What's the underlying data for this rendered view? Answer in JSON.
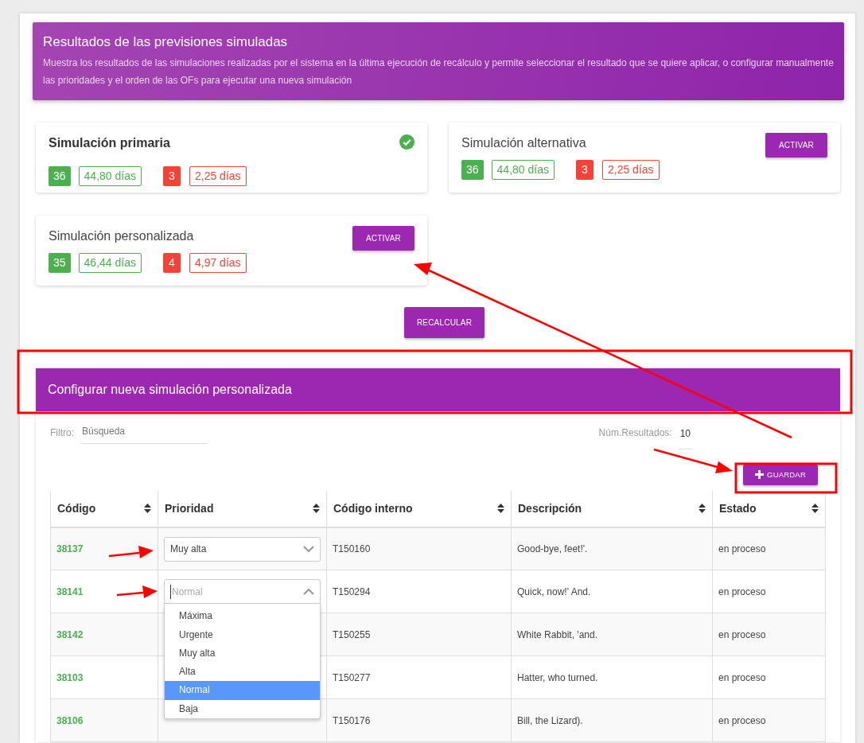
{
  "header": {
    "title": "Resultados de las previsiones simuladas",
    "description": "Muestra los resultados de las simulaciones realizadas por el sistema en la última ejecución de recálculo y permite seleccionar el resultado que se quiere aplicar, o configurar manualmente las prioridades y el orden de las OFs para ejecutar una nueva simulación"
  },
  "simulations": [
    {
      "title": "Simulación primaria",
      "active": true,
      "on_time_count": "36",
      "on_time_days": "44,80 días",
      "late_count": "3",
      "late_days": "2,25 días"
    },
    {
      "title": "Simulación alternativa",
      "active": false,
      "button": "ACTIVAR",
      "on_time_count": "36",
      "on_time_days": "44,80 días",
      "late_count": "3",
      "late_days": "2,25 días"
    },
    {
      "title": "Simulación personalizada",
      "active": false,
      "button": "ACTIVAR",
      "on_time_count": "35",
      "on_time_days": "46,44 días",
      "late_count": "4",
      "late_days": "4,97 días"
    }
  ],
  "recalculate_button": "RECALCULAR",
  "custom_section": {
    "title": "Configurar nueva simulación personalizada",
    "filter": {
      "label": "Filtro:",
      "placeholder": "Búsqueda"
    },
    "results": {
      "label": "Núm.Resultados:",
      "value": "10"
    },
    "save_button": "GUARDAR"
  },
  "table": {
    "columns": [
      "Código",
      "Prioridad",
      "Código interno",
      "Descripción",
      "Estado"
    ],
    "rows": [
      {
        "code": "38137",
        "priority": "Muy alta",
        "internal_code": "T150160",
        "description": "Good-bye, feet!'.",
        "status": "en proceso"
      },
      {
        "code": "38141",
        "placeholder": "Normal",
        "expanded": true,
        "internal_code": "T150294",
        "description": "Quick, now!' And.",
        "status": "en proceso"
      },
      {
        "code": "38142",
        "internal_code": "T150255",
        "description": "White Rabbit, 'and.",
        "status": "en proceso"
      },
      {
        "code": "38103",
        "internal_code": "T150277",
        "description": "Hatter, who turned.",
        "status": "en proceso"
      },
      {
        "code": "38106",
        "internal_code": "T150176",
        "description": "Bill, the Lizard).",
        "status": "en proceso"
      }
    ]
  },
  "dropdown": {
    "options": [
      {
        "label": "Máxima",
        "selected": false
      },
      {
        "label": "Urgente",
        "selected": false
      },
      {
        "label": "Muy alta",
        "selected": false
      },
      {
        "label": "Alta",
        "selected": false
      },
      {
        "label": "Normal",
        "selected": true
      },
      {
        "label": "Baja",
        "selected": false
      }
    ]
  }
}
